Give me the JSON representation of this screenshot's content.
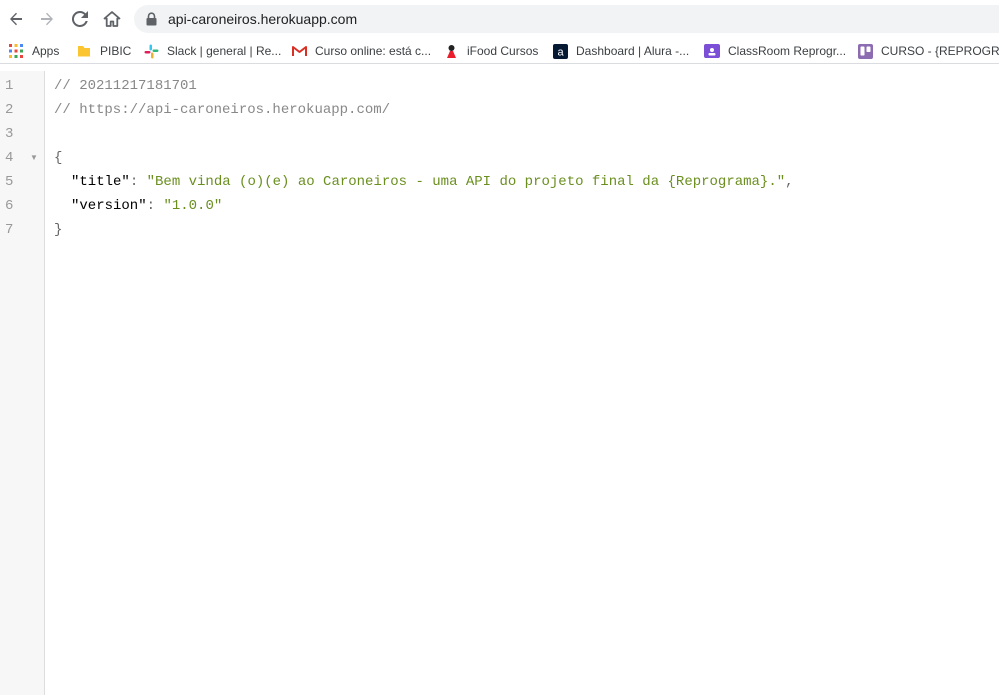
{
  "browser": {
    "url": "api-caroneiros.herokuapp.com"
  },
  "bookmarks": [
    {
      "label": "Apps",
      "icon": "apps-grid-icon"
    },
    {
      "label": "PIBIC",
      "icon": "folder-icon"
    },
    {
      "label": "Slack | general | Re...",
      "icon": "slack-icon"
    },
    {
      "label": "Curso online: está c...",
      "icon": "gmail-icon"
    },
    {
      "label": "iFood Cursos",
      "icon": "ifood-icon"
    },
    {
      "label": "Dashboard | Alura -...",
      "icon": "alura-icon"
    },
    {
      "label": "ClassRoom Reprogr...",
      "icon": "classroom-icon"
    },
    {
      "label": "CURSO - {REPROGR...",
      "icon": "trello-icon"
    }
  ],
  "code": {
    "line_numbers": [
      "1",
      "2",
      "3",
      "4",
      "5",
      "6",
      "7"
    ],
    "comment_timestamp": "// 20211217181701",
    "comment_url": "// https://api-caroneiros.herokuapp.com/",
    "open_brace": "{",
    "close_brace": "}",
    "title_key": "\"title\"",
    "title_value": "\"Bem vinda (o)(e) ao Caroneiros - uma API do projeto final da {Reprograma}.\"",
    "version_key": "\"version\"",
    "version_value": "\"1.0.0\""
  },
  "colors": {
    "string": "#6a8f1f",
    "comment": "#888888",
    "gutter_bg": "#f7f7f7"
  }
}
